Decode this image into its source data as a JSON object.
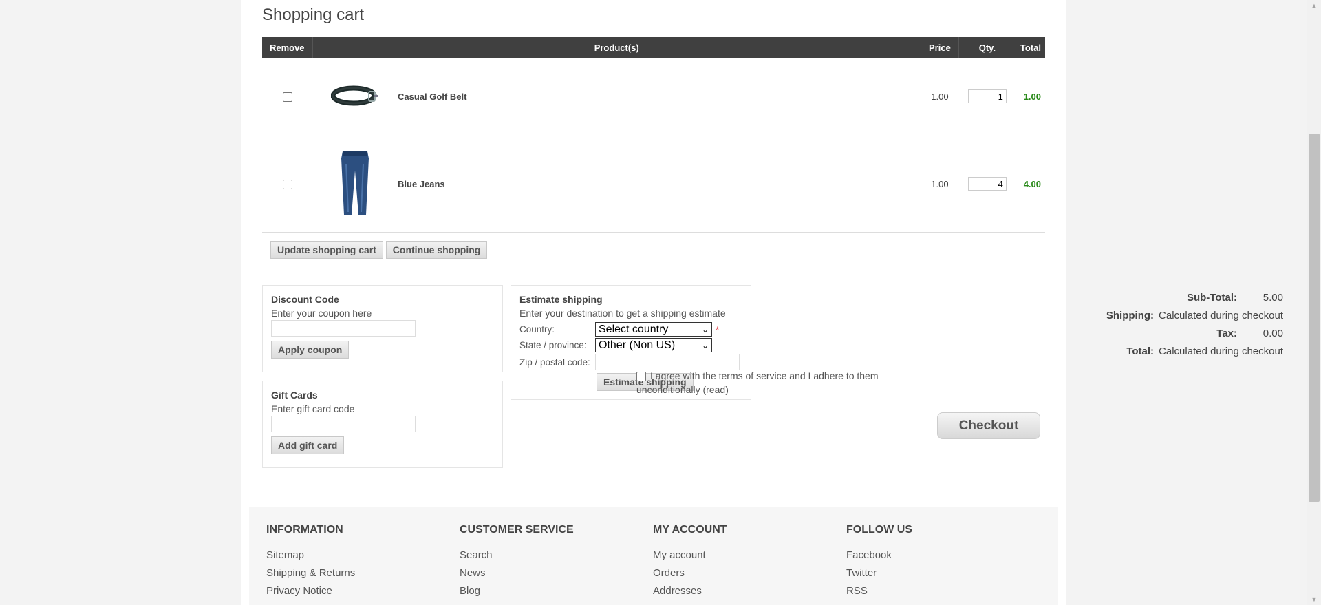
{
  "page_title": "Shopping cart",
  "cart": {
    "headers": {
      "remove": "Remove",
      "products": "Product(s)",
      "price": "Price",
      "qty": "Qty.",
      "total": "Total"
    },
    "items": [
      {
        "name": "Casual Golf Belt",
        "price": "1.00",
        "qty": "1",
        "total": "1.00",
        "image": "belt-image"
      },
      {
        "name": "Blue Jeans",
        "price": "1.00",
        "qty": "4",
        "total": "4.00",
        "image": "jeans-image"
      }
    ],
    "update_button": "Update shopping cart",
    "continue_button": "Continue shopping"
  },
  "discount": {
    "title": "Discount Code",
    "hint": "Enter your coupon here",
    "button": "Apply coupon"
  },
  "giftcards": {
    "title": "Gift Cards",
    "hint": "Enter gift card code",
    "button": "Add gift card"
  },
  "estimate": {
    "title": "Estimate shipping",
    "hint": "Enter your destination to get a shipping estimate",
    "country_label": "Country:",
    "country_value": "Select country",
    "state_label": "State / province:",
    "state_value": "Other (Non US)",
    "zip_label": "Zip / postal code:",
    "button": "Estimate shipping",
    "required_mark": "*"
  },
  "totals": {
    "subtotal_label": "Sub-Total:",
    "subtotal_value": "5.00",
    "shipping_label": "Shipping:",
    "shipping_value": "Calculated during checkout",
    "tax_label": "Tax:",
    "tax_value": "0.00",
    "total_label": "Total:",
    "total_value": "Calculated during checkout"
  },
  "terms": {
    "text": "I agree with the terms of service and I adhere to them unconditionally",
    "link": "(read)"
  },
  "checkout_button": "Checkout",
  "footer": {
    "columns": [
      {
        "title": "INFORMATION",
        "links": [
          "Sitemap",
          "Shipping & Returns",
          "Privacy Notice"
        ]
      },
      {
        "title": "CUSTOMER SERVICE",
        "links": [
          "Search",
          "News",
          "Blog"
        ]
      },
      {
        "title": "MY ACCOUNT",
        "links": [
          "My account",
          "Orders",
          "Addresses"
        ]
      },
      {
        "title": "FOLLOW US",
        "links": [
          "Facebook",
          "Twitter",
          "RSS"
        ]
      }
    ]
  },
  "colors": {
    "header_bg": "#404040",
    "total_green": "#2a8a1a",
    "required_red": "#e4434b"
  }
}
